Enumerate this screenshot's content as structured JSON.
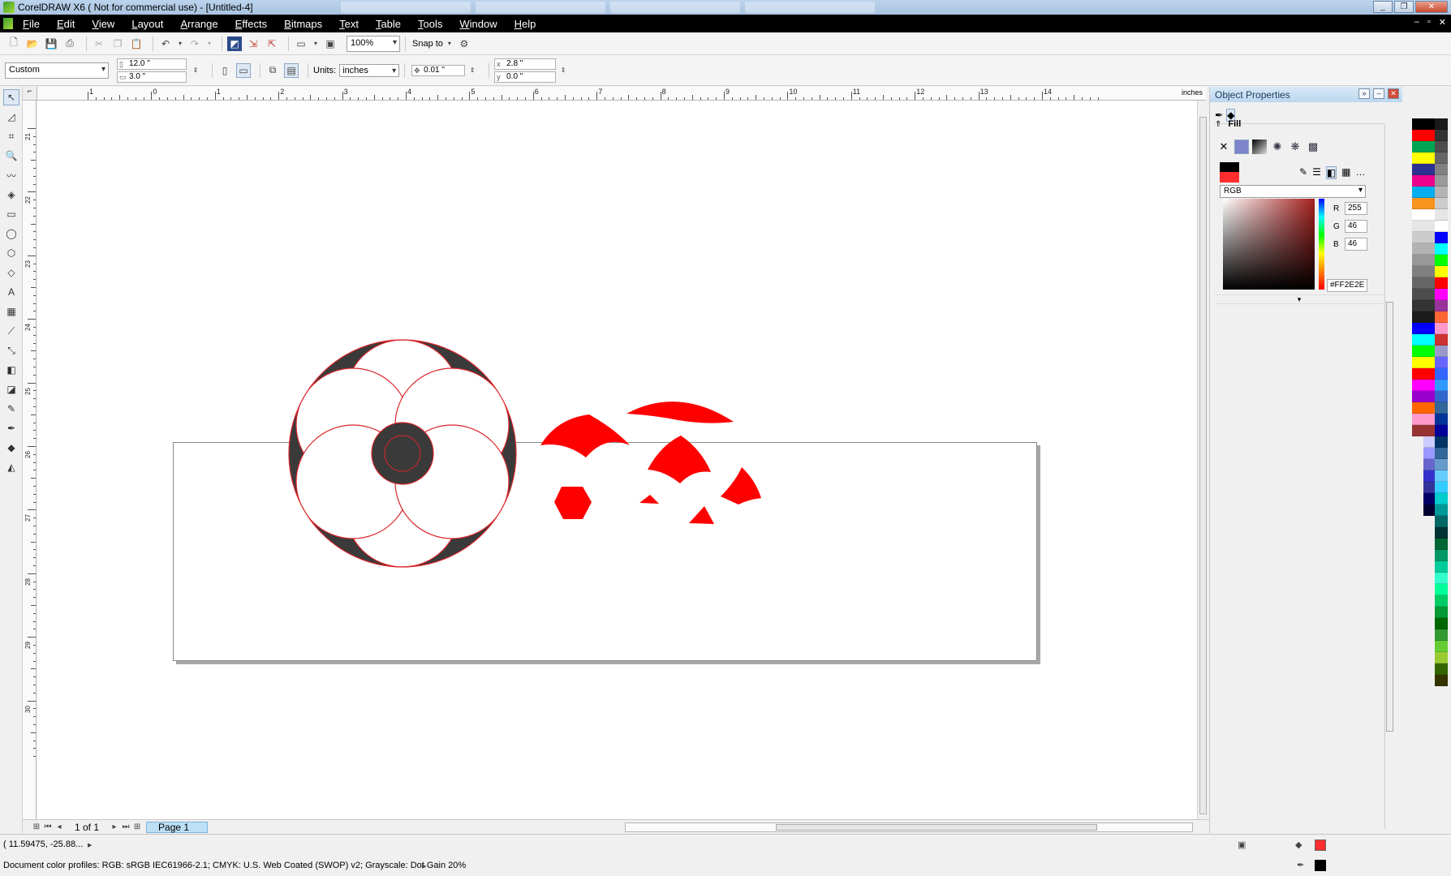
{
  "window": {
    "title": "CorelDRAW X6 ( Not for commercial use) - [Untitled-4]"
  },
  "menu": [
    "File",
    "Edit",
    "View",
    "Layout",
    "Arrange",
    "Effects",
    "Bitmaps",
    "Text",
    "Table",
    "Tools",
    "Window",
    "Help"
  ],
  "toolbar": {
    "zoom": "100%",
    "snap_label": "Snap to"
  },
  "propbar": {
    "preset": "Custom",
    "width": "12.0 \"",
    "height": "3.0 \"",
    "units_label": "Units:",
    "units_value": "inches",
    "nudge": "0.01 \"",
    "dup_x": "2.8 \"",
    "dup_y": "0.0 \""
  },
  "ruler": {
    "units": "inches",
    "h_labels": [
      "1",
      "0",
      "1",
      "2",
      "3",
      "4",
      "5",
      "6",
      "7",
      "8",
      "9",
      "10",
      "11",
      "12",
      "13",
      "14"
    ],
    "v_labels": [
      "21",
      "22",
      "23",
      "24",
      "25",
      "26",
      "27",
      "28",
      "29",
      "30"
    ]
  },
  "docker": {
    "title": "Object Properties",
    "fill_label": "Fill",
    "color_model": "RGB",
    "r": "255",
    "g": "46",
    "b": "46",
    "hex": "#FF2E2E",
    "r_label": "R",
    "g_label": "G",
    "b_label": "B"
  },
  "pagenav": {
    "count": "1 of 1",
    "page_tab": "Page 1"
  },
  "status": {
    "coords": "( 11.59475, -25.88... ",
    "profiles": "Document color profiles: RGB: sRGB IEC61966-2.1; CMYK: U.S. Web Coated (SWOP) v2; Grayscale: Dot Gain 20%"
  },
  "colors": {
    "fill": "#FF2E2E",
    "shape_dark": "#3a3a3a",
    "outline": "#d9252a"
  },
  "palette": {
    "col1": [
      "#000000",
      "#ff0000",
      "#00a651",
      "#ffff00",
      "#2e3192",
      "#ec008c",
      "#00aeef",
      "#f7941d",
      "#ffffff",
      "#e6e6e6",
      "#cccccc",
      "#b3b3b3",
      "#999999",
      "#808080",
      "#666666",
      "#4d4d4d",
      "#333333",
      "#1a1a1a",
      "#0000ff",
      "#00ffff",
      "#00ff00",
      "#ffff00",
      "#ff0000",
      "#ff00ff",
      "#9900cc",
      "#ff6600",
      "#ff99cc",
      "#993333",
      "#ccccff",
      "#9999ff",
      "#6666cc",
      "#3333cc",
      "#333399",
      "#000066",
      "#000033"
    ],
    "col2": [
      "#1a1a1a",
      "#333333",
      "#4d4d4d",
      "#666666",
      "#808080",
      "#999999",
      "#b3b3b3",
      "#cccccc",
      "#e6e6e6",
      "#ffffff",
      "#0000ff",
      "#00ffff",
      "#00ff00",
      "#ffff00",
      "#ff0000",
      "#ff00ff",
      "#993399",
      "#ff6633",
      "#ff99cc",
      "#cc3333",
      "#9999cc",
      "#6666ff",
      "#3366ff",
      "#3399ff",
      "#3366cc",
      "#336699",
      "#003399",
      "#000099",
      "#003366",
      "#336699",
      "#6699cc",
      "#66ccff",
      "#33ccff",
      "#00cccc",
      "#009999",
      "#006666",
      "#003333",
      "#006633",
      "#009966",
      "#00cc99",
      "#33ffcc",
      "#00ff99",
      "#00cc66",
      "#009933",
      "#006600",
      "#339933",
      "#66cc33",
      "#99cc33",
      "#336600",
      "#333300"
    ]
  }
}
